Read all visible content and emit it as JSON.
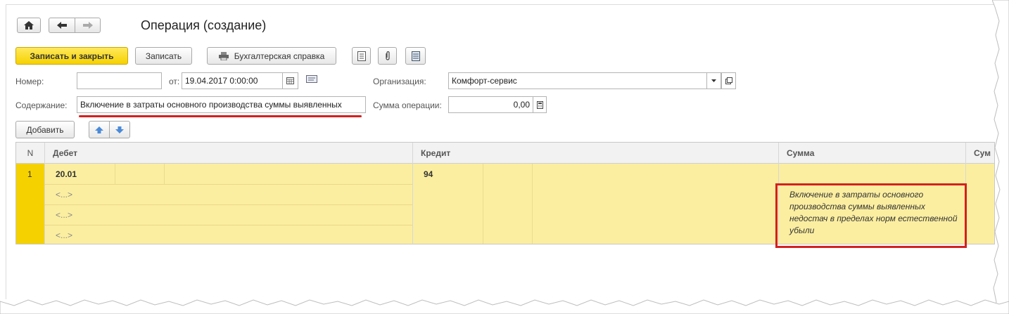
{
  "window": {
    "title": "Операция (создание)"
  },
  "toolbar": {
    "save_close": "Записать и закрыть",
    "save": "Записать",
    "report": "Бухгалтерская справка"
  },
  "form": {
    "number_label": "Номер:",
    "number_value": "",
    "date_label": "от:",
    "date_value": "19.04.2017  0:00:00",
    "org_label": "Организация:",
    "org_value": "Комфорт-сервис",
    "content_label": "Содержание:",
    "content_value": "Включение в затраты основного производства суммы выявленных",
    "sum_label": "Сумма операции:",
    "sum_value": "0,00"
  },
  "table_toolbar": {
    "add": "Добавить"
  },
  "table": {
    "headers": {
      "n": "N",
      "debit": "Дебет",
      "credit": "Кредит",
      "sum": "Сумма",
      "sum_cut": "Сум"
    },
    "row": {
      "n": "1",
      "debit": "20.01",
      "credit": "94",
      "subconto": [
        "<...>",
        "<...>",
        "<...>"
      ]
    }
  },
  "annotation": {
    "text": "Включение в затраты основного производства суммы выявленных недостач в пределах норм естественной убыли"
  },
  "colors": {
    "accent_yellow": "#f5d100",
    "row_yellow": "#fbeea0",
    "highlight_red": "#d42020"
  }
}
